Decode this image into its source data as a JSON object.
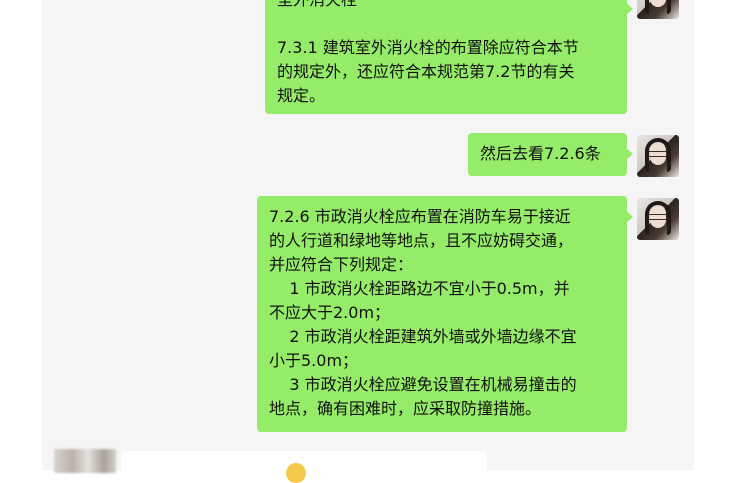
{
  "conversation": {
    "messages": [
      {
        "sender": "me",
        "lines": [
          "室外消火栓",
          "",
          "7.3.1 建筑室外消火栓的布置除应符合本节",
          "的规定外，还应符合本规范第7.2节的有关",
          "规定。"
        ]
      },
      {
        "sender": "me",
        "lines": [
          "然后去看7.2.6条"
        ]
      },
      {
        "sender": "me",
        "lines": [
          "7.2.6 市政消火栓应布置在消防车易于接近",
          "的人行道和绿地等地点，且不应妨碍交通，",
          "并应符合下列规定：",
          "    1 市政消火栓距路边不宜小于0.5m，并",
          "不应大于2.0m；",
          "    2 市政消火栓距建筑外墙或外墙边缘不宜",
          "小于5.0m；",
          "    3 市政消火栓应避免设置在机械易撞击的",
          "地点，确有困难时，应采取防撞措施。"
        ]
      },
      {
        "sender": "other",
        "lines": []
      }
    ]
  },
  "colors": {
    "my_bubble": "#95ec69",
    "chat_bg": "#f5f5f5",
    "other_bubble": "#ffffff"
  },
  "icons": {
    "my_avatar": "avatar-icon",
    "other_avatar": "avatar-icon",
    "emoji": "smiley-icon"
  }
}
